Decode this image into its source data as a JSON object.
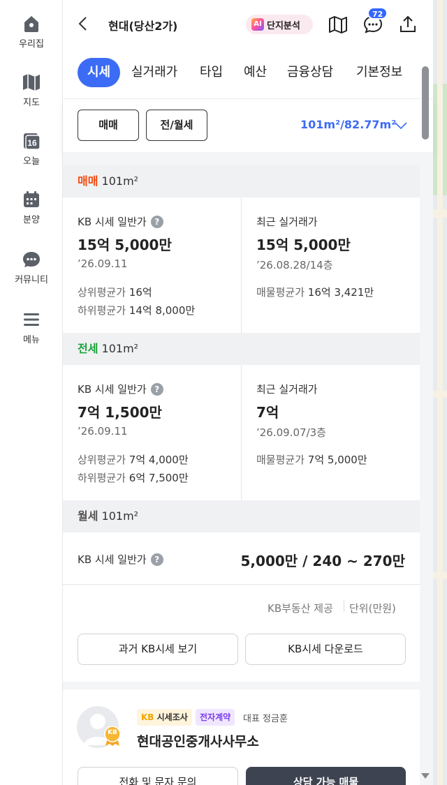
{
  "nav": {
    "items": [
      {
        "label": "우리집",
        "icon": "house-icon"
      },
      {
        "label": "지도",
        "icon": "map-icon"
      },
      {
        "label": "오늘",
        "icon": "calendar-today-icon",
        "day": "16"
      },
      {
        "label": "분양",
        "icon": "calendar-icon"
      },
      {
        "label": "커뮤니티",
        "icon": "chat-bubble-icon"
      },
      {
        "label": "메뉴",
        "icon": "hamburger-icon"
      }
    ]
  },
  "header": {
    "title": "현대(당산2가)",
    "ai_label": "AI",
    "analysis_label": "단지분석",
    "chat_badge": "72"
  },
  "tabs": [
    "시세",
    "실거래가",
    "타입",
    "예산",
    "금융상담",
    "기본정보"
  ],
  "deal_types": [
    "매매",
    "전/월세"
  ],
  "area_selector": "101m²/82.77m²",
  "sale": {
    "section_kind": "매매",
    "section_area": "101m²",
    "kb_label": "KB 시세 일반가",
    "kb_price": "15억 5,000만",
    "kb_date": "’26.09.11",
    "upper_label": "상위평균가",
    "upper_value": "16억",
    "lower_label": "하위평균가",
    "lower_value": "14억 8,000만",
    "recent_label": "최근 실거래가",
    "recent_price": "15억 5,000만",
    "recent_date": "’26.08.28/14층",
    "listing_label": "매물평균가",
    "listing_value": "16억 3,421만"
  },
  "jeonse": {
    "section_kind": "전세",
    "section_area": "101m²",
    "kb_label": "KB 시세 일반가",
    "kb_price": "7억 1,500만",
    "kb_date": "’26.09.11",
    "upper_label": "상위평균가",
    "upper_value": "7억 4,000만",
    "lower_label": "하위평균가",
    "lower_value": "6억 7,500만",
    "recent_label": "최근 실거래가",
    "recent_price": "7억",
    "recent_date": "’26.09.07/3층",
    "listing_label": "매물평균가",
    "listing_value": "7억 5,000만"
  },
  "monthly": {
    "section_kind": "월세",
    "section_area": "101m²",
    "kb_label": "KB 시세 일반가",
    "kb_price": "5,000만 / 240 ~ 270만"
  },
  "footer": {
    "provider": "KB부동산 제공",
    "unit": "단위(만원)",
    "past_button": "과거 KB시세 보기",
    "download_button": "KB시세 다운로드"
  },
  "agent": {
    "tag_kb_prefix": "KB",
    "tag_kb": "시세조사",
    "tag_contract": "전자계약",
    "rep": "대표 정금훈",
    "name": "현대공인중개사사무소",
    "medal_text": "KB",
    "call_button": "전화 및 문자 문의",
    "listings_button": "상담 가능 매물"
  },
  "colors": {
    "accent": "#3c6cf5",
    "sale": "#f04b12",
    "jeonse": "#1aa33a"
  }
}
